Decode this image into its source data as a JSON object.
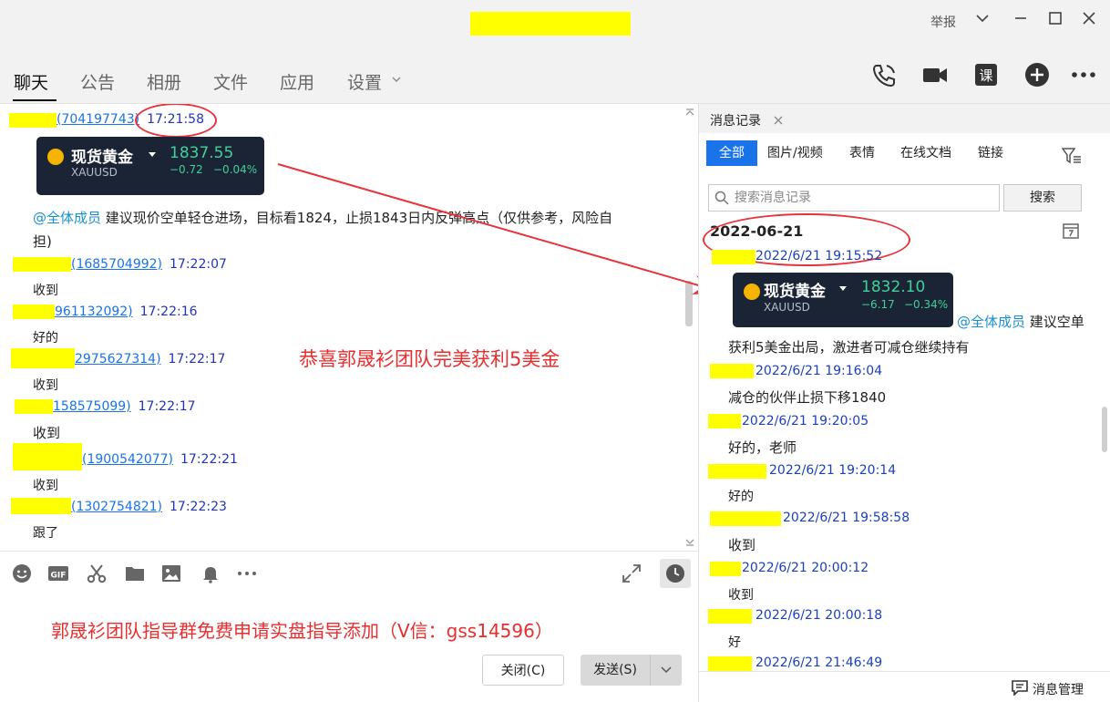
{
  "titlebar": {
    "report": "举报"
  },
  "tabs": [
    "聊天",
    "公告",
    "相册",
    "文件",
    "应用",
    "设置"
  ],
  "chat": {
    "messages": [
      {
        "id": "(704197743)",
        "time": "17:21:58"
      },
      {
        "id": "(1685704992)",
        "time": "17:22:07",
        "text": "收到"
      },
      {
        "id": "961132092)",
        "time": "17:22:16",
        "text": "好的"
      },
      {
        "id": "2975627314)",
        "time": "17:22:17",
        "text": "收到"
      },
      {
        "id": "158575099)",
        "time": "17:22:17",
        "text": "收到"
      },
      {
        "id": "(1900542077)",
        "time": "17:22:21",
        "text": "收到"
      },
      {
        "id": "(1302754821)",
        "time": "17:22:23",
        "text": "跟了"
      }
    ],
    "mention": "@全体成员",
    "advice": "建议现价空单轻仓进场，目标看1824，止损1843日内反弹高点（仅供参考，风险自",
    "advice2": "担)",
    "card": {
      "name": "现货黄金",
      "symbol": "XAUUSD",
      "price": "1837.55",
      "change": "−0.72",
      "pct": "−0.04%"
    }
  },
  "annotations": {
    "congrats": "恭喜郭晟衫团队完美获利5美金",
    "promo": "郭晟衫团队指导群免费申请实盘指导添加（V信：gss14596）"
  },
  "buttons": {
    "close": "关闭(C)",
    "send": "发送(S)"
  },
  "history": {
    "title": "消息记录",
    "tabs": [
      "全部",
      "图片/视频",
      "表情",
      "在线文档",
      "链接"
    ],
    "search_placeholder": "搜索消息记录",
    "search_btn": "搜索",
    "date": "2022-06-21",
    "card": {
      "name": "现货黄金",
      "symbol": "XAUUSD",
      "price": "1832.10",
      "change": "−6.17",
      "pct": "−0.34%"
    },
    "mention": "@全体成员",
    "advice": "建议空单",
    "entries": [
      {
        "time": "2022/6/21 19:15:52"
      },
      {
        "time": "2022/6/21 19:16:04",
        "text": "获利5美金出局，激进者可减仓继续持有"
      },
      {
        "time": "2022/6/21 19:20:05",
        "text": "减仓的伙伴止损下移1840"
      },
      {
        "time": "2022/6/21 19:20:14",
        "text": "好的，老师"
      },
      {
        "time": "2022/6/21 19:58:58",
        "text": "好的"
      },
      {
        "time": "2022/6/21 20:00:12",
        "text": "收到"
      },
      {
        "time": "2022/6/21 20:00:18",
        "text": "收到"
      },
      {
        "time": "2022/6/21 21:46:49",
        "text": "好"
      }
    ],
    "manage": "消息管理"
  }
}
